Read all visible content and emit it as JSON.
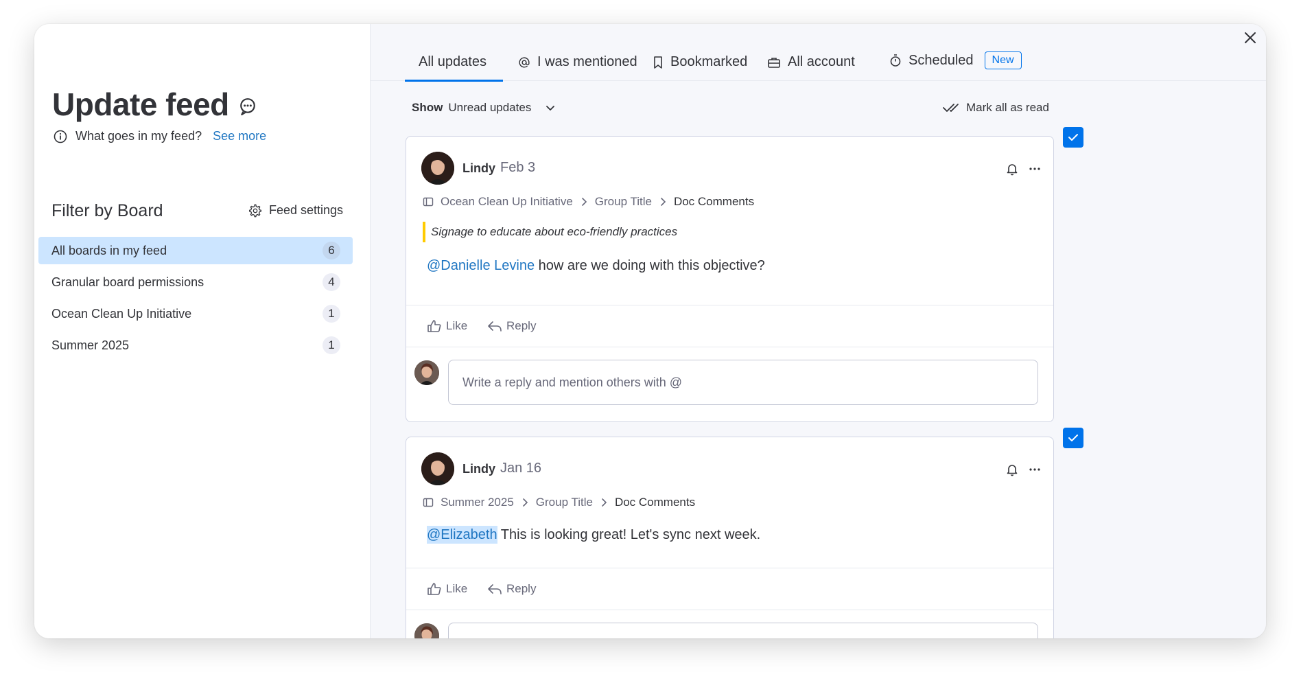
{
  "sidebar": {
    "title": "Update feed",
    "info_text": "What goes in my feed?",
    "info_link": "See more",
    "filter_title": "Filter by Board",
    "feed_settings": "Feed settings",
    "boards": [
      {
        "label": "All boards in my feed",
        "count": "6"
      },
      {
        "label": "Granular board permissions",
        "count": "4"
      },
      {
        "label": "Ocean Clean Up Initiative",
        "count": "1"
      },
      {
        "label": "Summer 2025",
        "count": "1"
      }
    ]
  },
  "tabs": [
    {
      "label": "All updates"
    },
    {
      "label": "I was mentioned"
    },
    {
      "label": "Bookmarked"
    },
    {
      "label": "All account"
    },
    {
      "label": "Scheduled",
      "badge": "New"
    }
  ],
  "toolbar": {
    "show_label": "Show",
    "show_value": "Unread updates",
    "mark_all": "Mark all as read"
  },
  "posts": [
    {
      "author": "Lindy",
      "date": "Feb 3",
      "breadcrumb": [
        "Ocean Clean Up Initiative",
        "Group Title",
        "Doc Comments"
      ],
      "quote": "Signage to educate about eco-friendly practices",
      "mention": "@Danielle Levine",
      "text": " how are we doing with this objective?",
      "like": "Like",
      "reply": "Reply",
      "reply_placeholder": "Write a reply and mention others with @"
    },
    {
      "author": "Lindy",
      "date": "Jan 16",
      "breadcrumb": [
        "Summer 2025",
        "Group Title",
        "Doc Comments"
      ],
      "mention": "@Elizabeth",
      "text": " This is looking great! Let's sync next week.",
      "like": "Like",
      "reply": "Reply"
    }
  ],
  "colors": {
    "accent": "#0073ea",
    "selected_bg": "#cce5ff",
    "quote_bar": "#ffcb00",
    "link": "#1f76c2"
  }
}
